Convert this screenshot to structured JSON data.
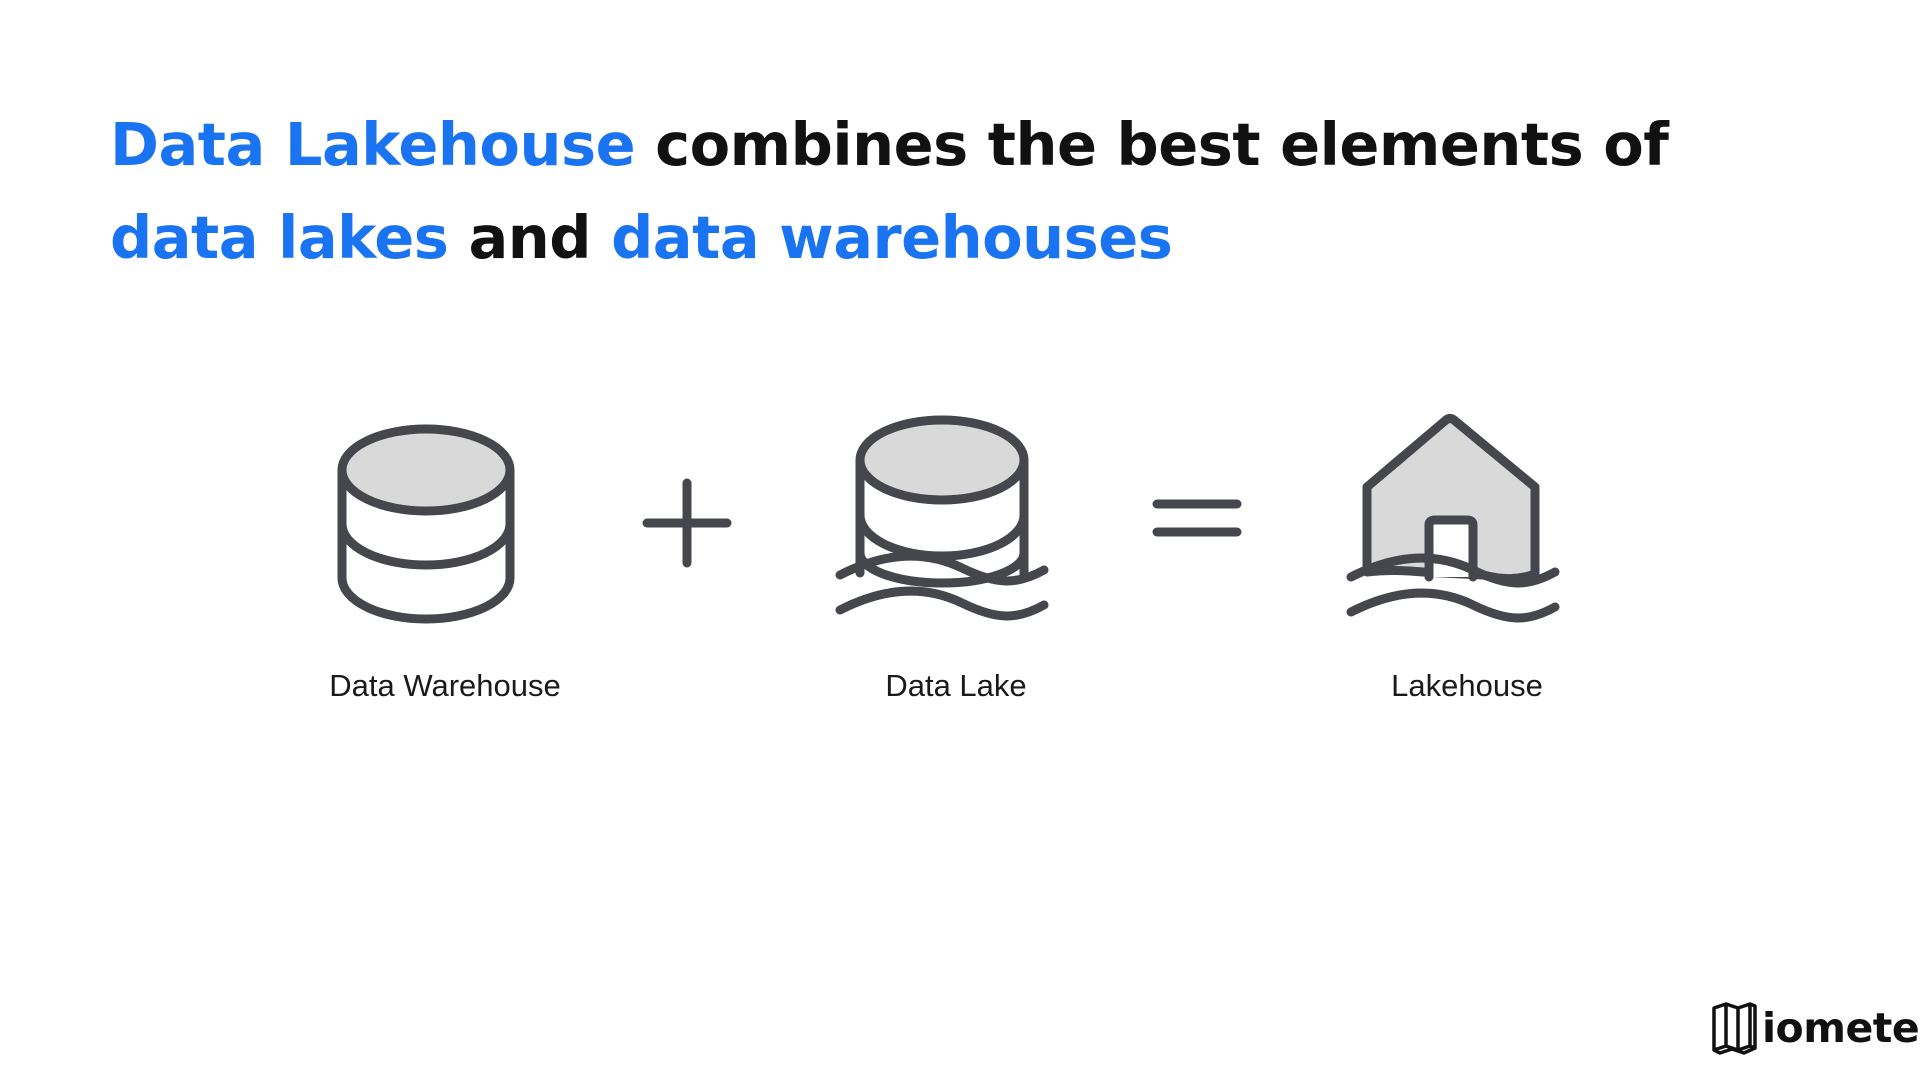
{
  "headline": {
    "seg1": "Data Lakehouse",
    "seg2": " combines the best elements of ",
    "seg3": "data lakes",
    "seg4": " and ",
    "seg5": "data warehouses"
  },
  "items": [
    {
      "label": "Data Warehouse",
      "icon": "database-icon"
    },
    {
      "label": "Data Lake",
      "icon": "database-on-water-icon"
    },
    {
      "label": "Lakehouse",
      "icon": "house-on-water-icon"
    }
  ],
  "operators": [
    "plus-icon",
    "equals-icon"
  ],
  "logo": {
    "text": "iomete"
  },
  "colors": {
    "accent": "#1a73f0",
    "text": "#111111",
    "icon_stroke": "#45474d",
    "icon_fill": "#d9d9d9"
  }
}
